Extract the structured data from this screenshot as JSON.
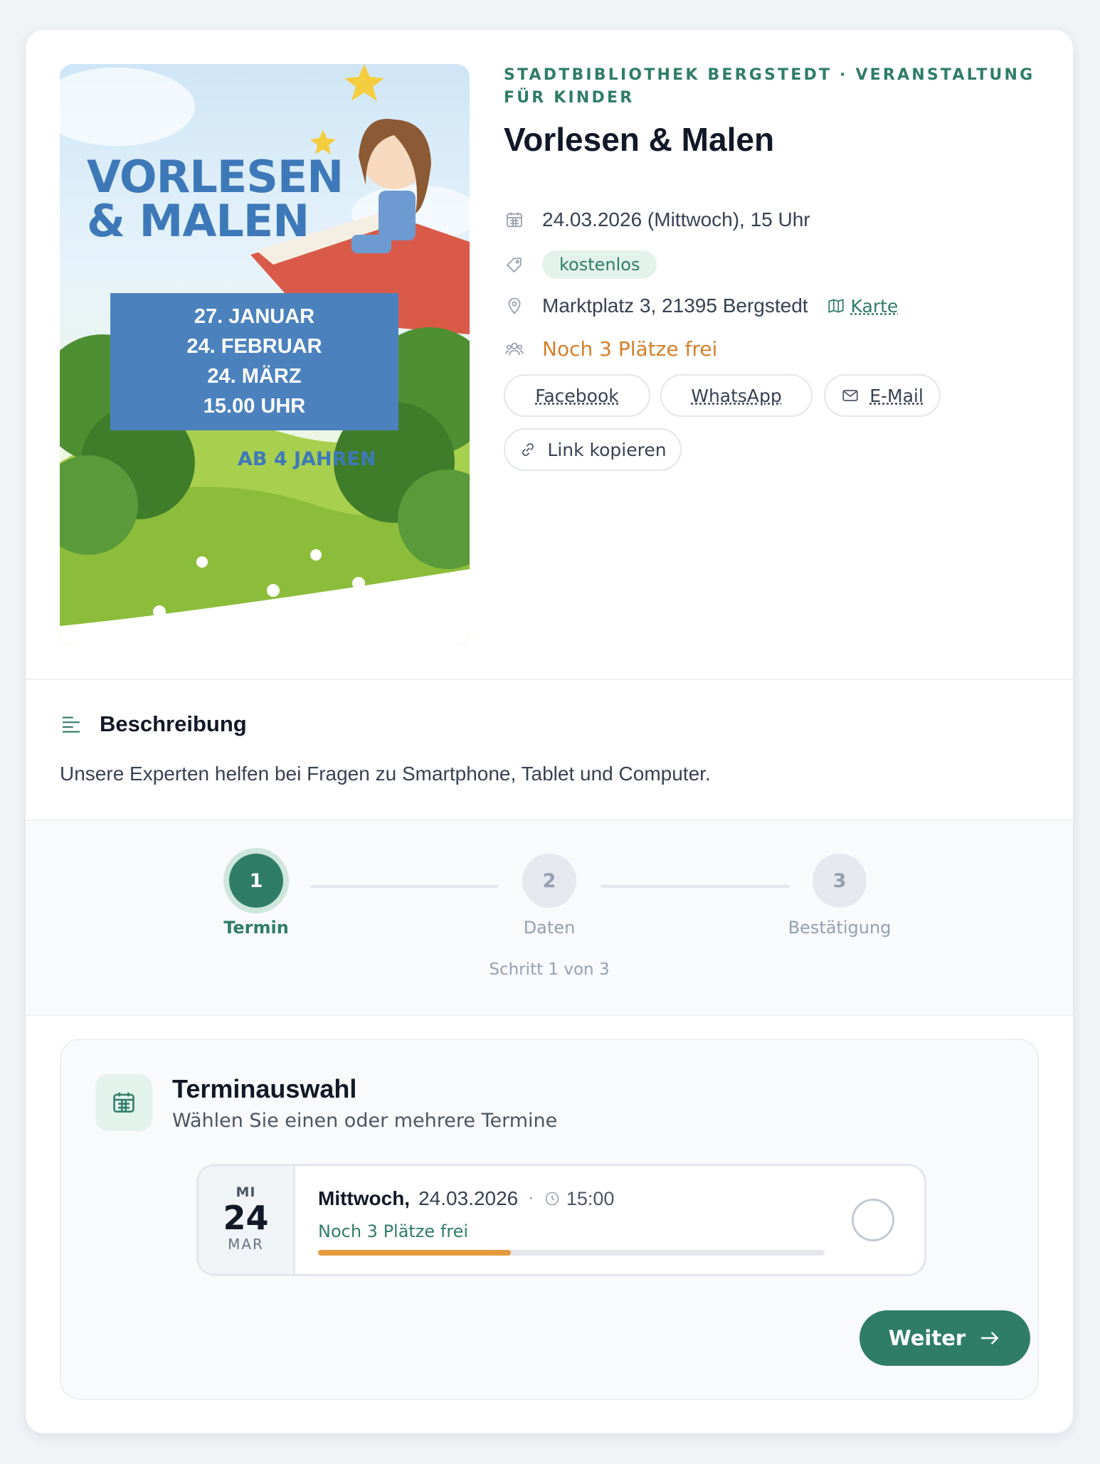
{
  "poster": {
    "title": "Vorlesen & Malen",
    "dates": [
      "27. JANUAR",
      "24. FEBRUAR",
      "24. MÄRZ",
      "15.00 UHR"
    ],
    "age": "AB 4 JAHREN"
  },
  "event": {
    "eyebrow": "Stadtbibliothek Bergstedt · Veranstaltung für Kinder",
    "title": "Vorlesen & Malen",
    "datetime": "24.03.2026 (Mittwoch), 15 Uhr",
    "price_badge": "kostenlos",
    "address": "Marktplatz 3, 21395 Bergstedt",
    "map_label": "Karte",
    "seats": "Noch 3 Plätze frei"
  },
  "share": {
    "facebook": "Facebook",
    "whatsapp": "WhatsApp",
    "email": "E-Mail",
    "copy": "Link kopieren"
  },
  "description": {
    "heading": "Beschreibung",
    "body": "Unsere Experten helfen bei Fragen zu Smartphone, Tablet und Computer."
  },
  "stepper": {
    "steps": [
      {
        "number": "1",
        "label": "Termin",
        "state": "active"
      },
      {
        "number": "2",
        "label": "Daten",
        "state": "idle"
      },
      {
        "number": "3",
        "label": "Bestätigung",
        "state": "idle"
      }
    ],
    "progress_text": "Schritt 1 von 3"
  },
  "booking": {
    "title": "Terminauswahl",
    "subtitle": "Wählen Sie einen oder mehrere Termine",
    "slot": {
      "dow": "MI",
      "day": "24",
      "month": "MAR",
      "weekday": "Mittwoch,",
      "date": "24.03.2026",
      "separator": "·",
      "time": "15:00",
      "seats": "Noch 3 Plätze frei",
      "fill_fraction": 0.38,
      "selected": false
    },
    "next_label": "Weiter"
  },
  "colors": {
    "accent": "#2f7d67",
    "accent_light": "#e4f2ec",
    "warning": "#d47f2a",
    "bar_fill": "#e39a3e"
  },
  "icons": {
    "date": "calendar-icon",
    "price": "tag-icon",
    "location": "map-pin-icon",
    "map": "map-icon",
    "seats": "users-icon",
    "email": "mail-icon",
    "copy": "link-icon",
    "description": "align-left-icon",
    "booking": "calendar-icon",
    "time": "clock-icon",
    "next": "arrow-right-icon"
  }
}
